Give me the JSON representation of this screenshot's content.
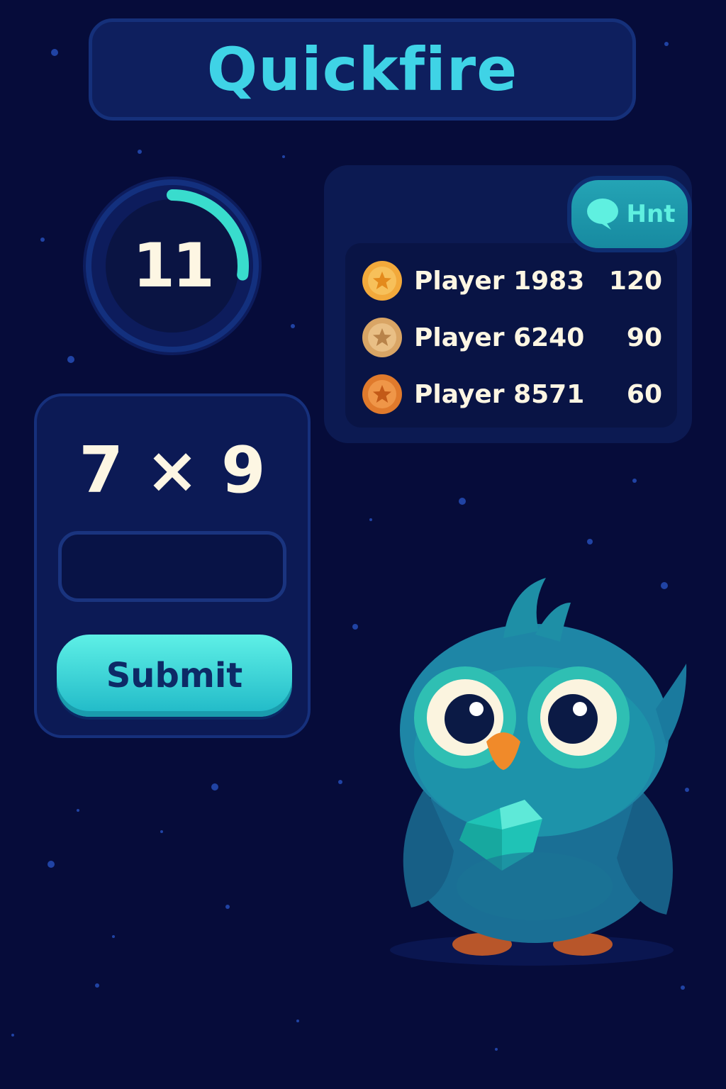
{
  "app": {
    "title": "Quickfire"
  },
  "timer": {
    "seconds": "11",
    "remaining_fraction": 0.27
  },
  "question": {
    "prompt": "7 × 9",
    "answer_value": "",
    "submit_label": "Submit"
  },
  "hint": {
    "label": "Hnt",
    "icon": "speech-bubble-icon"
  },
  "leaderboard": [
    {
      "name": "Player 1983",
      "score": "120",
      "medal": "gold",
      "medal_color": "#f2a93b"
    },
    {
      "name": "Player 6240",
      "score": "90",
      "medal": "silver",
      "medal_color": "#d9a565"
    },
    {
      "name": "Player 8571",
      "score": "60",
      "medal": "bronze",
      "medal_color": "#e07a2c"
    }
  ],
  "colors": {
    "background": "#060c3a",
    "accent": "#3fd3e6",
    "panel": "#0c1a55",
    "text": "#fdf6e3"
  },
  "mascot": {
    "icon": "owl-with-gem-icon"
  }
}
